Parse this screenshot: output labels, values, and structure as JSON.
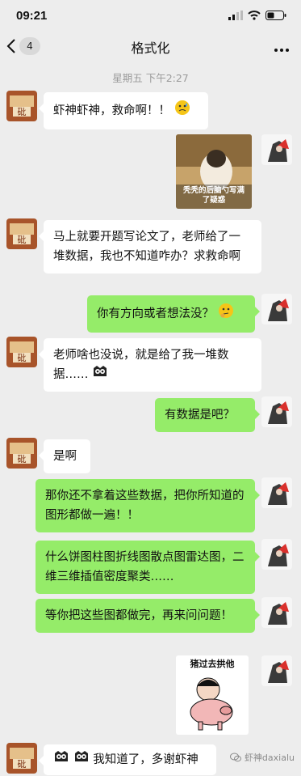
{
  "status_bar": {
    "time": "09:21"
  },
  "header": {
    "back_count": "4",
    "title": "格式化"
  },
  "timestamp": "星期五 下午2:27",
  "messages": [
    {
      "side": "left",
      "text": "虾神虾神，救命啊！！"
    },
    {
      "side": "right",
      "type": "sticker",
      "caption": "秃秃的后脑勺写满了疑惑"
    },
    {
      "side": "left",
      "text": "马上就要开题写论文了，老师给了一堆数据，我也不知道咋办？求救命啊"
    },
    {
      "side": "right",
      "text": "你有方向或者想法没？"
    },
    {
      "side": "left",
      "text": "老师啥也没说，就是给了我一堆数据……"
    },
    {
      "side": "right",
      "text": "有数据是吧？"
    },
    {
      "side": "left",
      "text": "是啊"
    },
    {
      "side": "right",
      "text": "那你还不拿着这些数据，把你所知道的图形都做一遍！！"
    },
    {
      "side": "right",
      "text": "什么饼图柱图折线图散点图雷达图，二维三维插值密度聚类……"
    },
    {
      "side": "right",
      "text": "等你把这些图都做完，再来问问题！"
    },
    {
      "side": "right",
      "type": "sticker",
      "caption": "猪过去拱他"
    },
    {
      "side": "left",
      "text": "我知道了，多谢虾神"
    }
  ],
  "watermark": "虾神daxialu",
  "colors": {
    "background": "#ededed",
    "bubble_right": "#95ec69",
    "bubble_left": "#ffffff"
  }
}
